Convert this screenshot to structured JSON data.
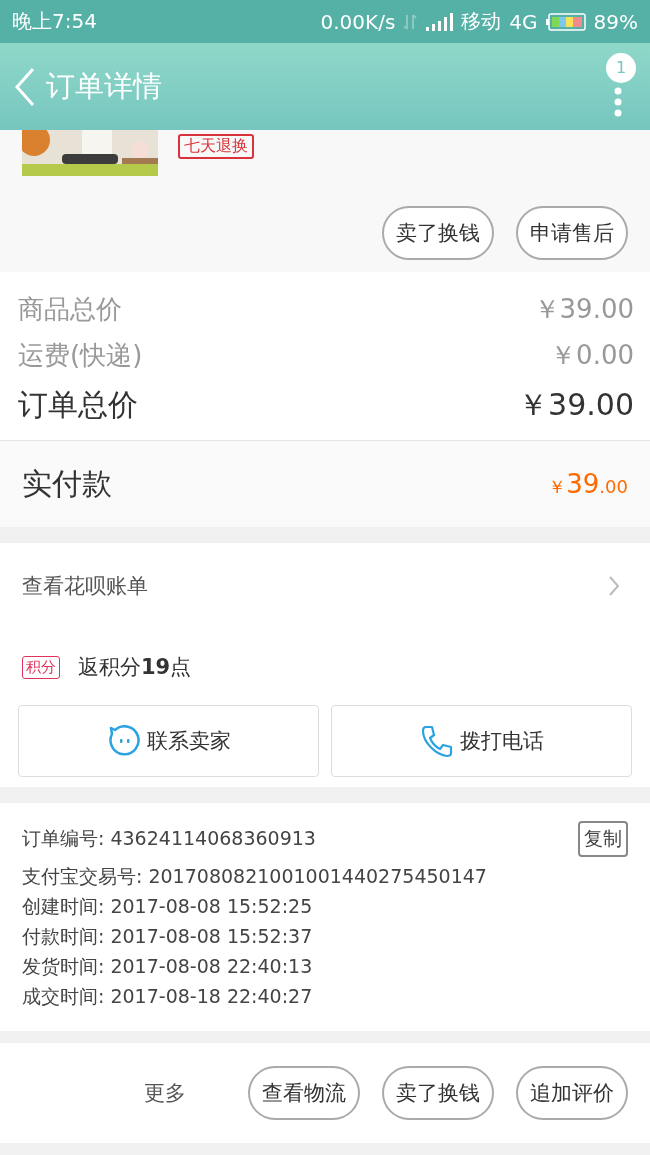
{
  "status_bar": {
    "time": "晚上7:54",
    "speed": "0.00K/s",
    "carrier": "移动",
    "network": "4G",
    "battery": "89%"
  },
  "header": {
    "title": "订单详情",
    "badge": "1"
  },
  "product": {
    "tag": "七天退换",
    "buttons": [
      "卖了换钱",
      "申请售后"
    ]
  },
  "prices": [
    {
      "label": "商品总价",
      "value": "￥39.00",
      "kind": "minor"
    },
    {
      "label": "运费(快递)",
      "value": "￥0.00",
      "kind": "minor"
    },
    {
      "label": "订单总价",
      "value": "￥39.00",
      "kind": "total"
    }
  ],
  "paid": {
    "label": "实付款",
    "currency": "￥",
    "integer": "39",
    "decimal": ".00"
  },
  "huabei": {
    "label": "查看花呗账单"
  },
  "points": {
    "tag": "积分",
    "text": "返积分**19**点"
  },
  "contact_buttons": [
    {
      "label": "联系卖家",
      "kind": "chat"
    },
    {
      "label": "拨打电话",
      "kind": "phone"
    }
  ],
  "order_info": {
    "copy_button": "复制",
    "lines": [
      "订单编号: 43624114068360913",
      "支付宝交易号: 2017080821001001440275450147",
      "创建时间: 2017-08-08 15:52:25",
      "付款时间: 2017-08-08 15:52:37",
      "发货时间: 2017-08-08 22:40:13",
      "成交时间: 2017-08-18 22:40:27"
    ]
  },
  "bottom_bar": {
    "more": "更多",
    "buttons": [
      "查看物流",
      "卖了换钱",
      "追加评价"
    ]
  }
}
